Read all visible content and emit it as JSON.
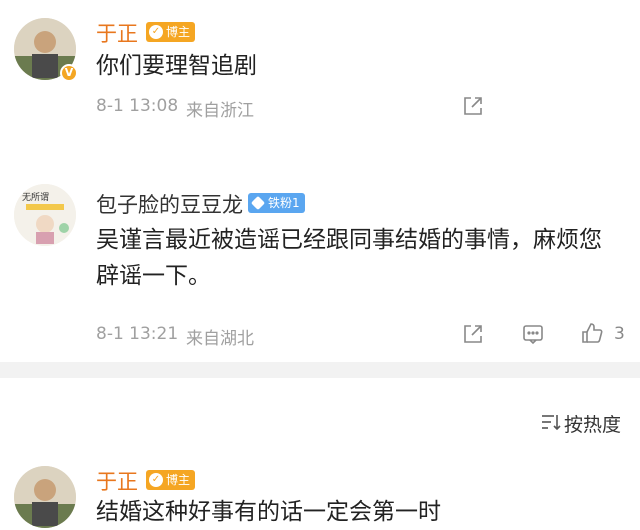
{
  "comments": [
    {
      "name": "于正",
      "badge": "博主",
      "text": "你们要理智追剧",
      "time": "8-1 13:08",
      "location": "来自浙江"
    },
    {
      "name": "包子脸的豆豆龙",
      "badge": "铁粉1",
      "text_line1": "吴谨言最近被造谣已经跟同事结婚的事情，麻烦您",
      "text_line2": "辟谣一下。",
      "time": "8-1 13:21",
      "location": "来自湖北",
      "like_count": "3"
    },
    {
      "name": "于正",
      "badge": "博主",
      "text": "结婚这种好事有的话一定会第一时"
    }
  ],
  "sort": {
    "label": "按热度"
  },
  "icons": [
    "share-icon",
    "comment-icon",
    "like-icon",
    "sort-icon",
    "verified-icon"
  ],
  "colors": {
    "name_orange": "#e8771e",
    "badge_orange": "#f5a623",
    "badge_blue": "#5aa6f0",
    "meta_gray": "#a0a0a0"
  }
}
